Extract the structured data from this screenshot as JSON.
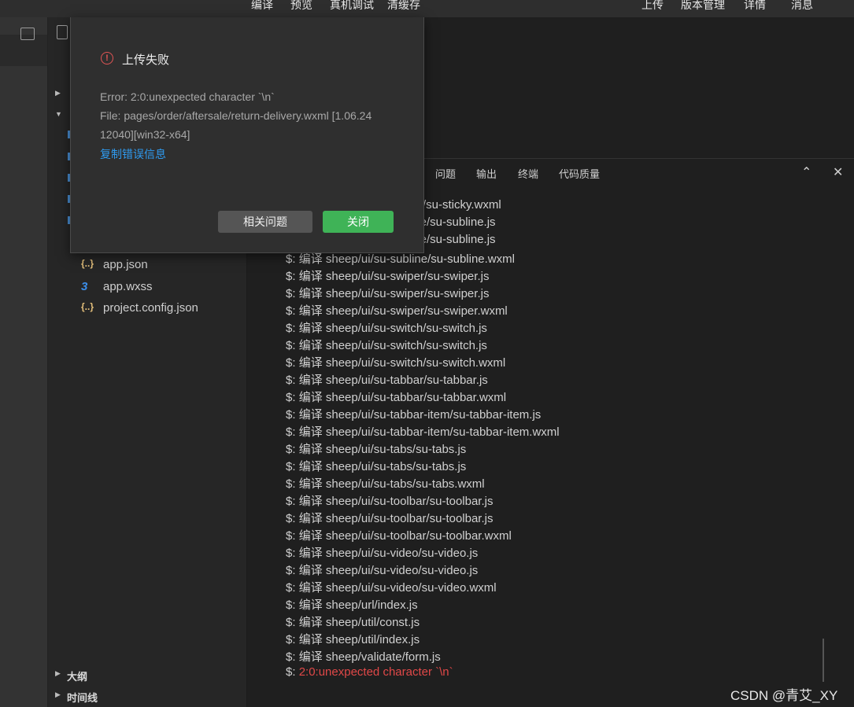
{
  "toolbar": {
    "items": [
      "编译",
      "预览",
      "真机调试",
      "清缓存",
      "上传",
      "版本管理",
      "详情",
      "消息"
    ]
  },
  "sidebar": {
    "files": [
      {
        "icon": "{..}",
        "name": "app.json"
      },
      {
        "icon": "3",
        "name": "app.wxss"
      },
      {
        "icon": "{..}",
        "name": "project.config.json"
      }
    ],
    "outline_label": "大纲",
    "timeline_label": "时间线"
  },
  "panel": {
    "tabs": [
      "问题",
      "输出",
      "终端",
      "代码质量"
    ]
  },
  "terminal": {
    "prompt": "$: ",
    "partial_lines": [
      "ky/su-sticky.wxml",
      "ine/su-subline.js",
      "ine/su-subline.js"
    ],
    "lines": [
      "编译 sheep/ui/su-subline/su-subline.wxml",
      "编译 sheep/ui/su-swiper/su-swiper.js",
      "编译 sheep/ui/su-swiper/su-swiper.js",
      "编译 sheep/ui/su-swiper/su-swiper.wxml",
      "编译 sheep/ui/su-switch/su-switch.js",
      "编译 sheep/ui/su-switch/su-switch.js",
      "编译 sheep/ui/su-switch/su-switch.wxml",
      "编译 sheep/ui/su-tabbar/su-tabbar.js",
      "编译 sheep/ui/su-tabbar/su-tabbar.wxml",
      "编译 sheep/ui/su-tabbar-item/su-tabbar-item.js",
      "编译 sheep/ui/su-tabbar-item/su-tabbar-item.wxml",
      "编译 sheep/ui/su-tabs/su-tabs.js",
      "编译 sheep/ui/su-tabs/su-tabs.js",
      "编译 sheep/ui/su-tabs/su-tabs.wxml",
      "编译 sheep/ui/su-toolbar/su-toolbar.js",
      "编译 sheep/ui/su-toolbar/su-toolbar.js",
      "编译 sheep/ui/su-toolbar/su-toolbar.wxml",
      "编译 sheep/ui/su-video/su-video.js",
      "编译 sheep/ui/su-video/su-video.js",
      "编译 sheep/ui/su-video/su-video.wxml",
      "编译 sheep/url/index.js",
      "编译 sheep/util/const.js",
      "编译 sheep/util/index.js",
      "编译 sheep/validate/form.js"
    ],
    "error_line": "2:0:unexpected character `\\n`"
  },
  "dialog": {
    "title": "上传失败",
    "error": "Error: 2:0:unexpected character `\\n`",
    "file_line1": "File: pages/order/aftersale/return-delivery.wxml [1.06.24",
    "file_line2": "12040][win32-x64]",
    "copy_link": "复制错误信息",
    "related_button": "相关问题",
    "close_button": "关闭"
  },
  "watermark": "CSDN @青艾_XY",
  "colors": {
    "error": "#e04848",
    "link": "#2f9bf0",
    "primary_button": "#3fb357"
  }
}
